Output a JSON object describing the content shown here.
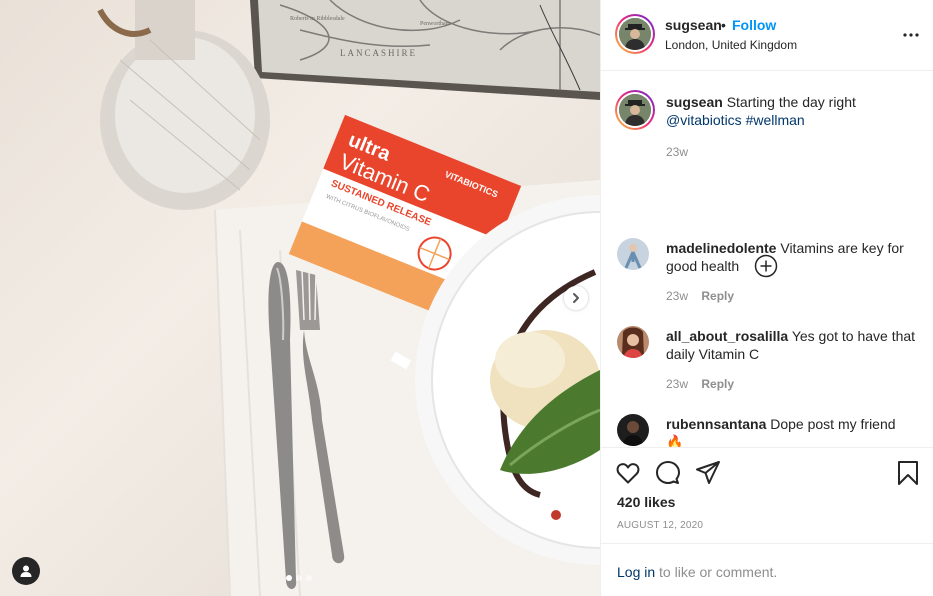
{
  "post": {
    "author": "sugsean",
    "follow_label": "Follow",
    "bullet": "•",
    "location": "London, United Kingdom",
    "more_icon": "more-horizontal-icon",
    "carousel": {
      "slides": 3,
      "active_slide": 1
    }
  },
  "caption": {
    "user": "sugsean",
    "text": "Starting the day right",
    "mention": "@vitabiotics",
    "hashtag": "#wellman",
    "time": "23w"
  },
  "comments": [
    {
      "user": "madelinedolente",
      "text": "Vitamins are key for good health",
      "time": "23w",
      "reply_label": "Reply"
    },
    {
      "user": "all_about_rosalilla",
      "text": "Yes got to have that daily Vitamin C",
      "time": "23w",
      "reply_label": "Reply"
    },
    {
      "user": "rubennsantana",
      "text": "Dope post my friend",
      "emoji": "🔥"
    }
  ],
  "engagement": {
    "likes": "420 likes",
    "date": "AUGUST 12, 2020"
  },
  "login_bar": {
    "link": "Log in",
    "rest": "to like or comment."
  },
  "photo": {
    "box_brand": "VITABIOTICS",
    "box_title": "ultra",
    "box_product": "Vitamin C",
    "box_subtitle": "SUSTAINED RELEASE",
    "box_note": "WITH CITRUS BIOFLAVONOIDS",
    "map_label": "LANCASHIRE",
    "map_text_1": "Penwortham",
    "map_text_2": "Roberts in Ribblesdale"
  },
  "colors": {
    "accent_blue": "#0095f6",
    "link_blue": "#00376b",
    "text": "#262626",
    "muted": "#8e8e8e",
    "divider": "#efefef",
    "box_orange": "#e8452c"
  }
}
